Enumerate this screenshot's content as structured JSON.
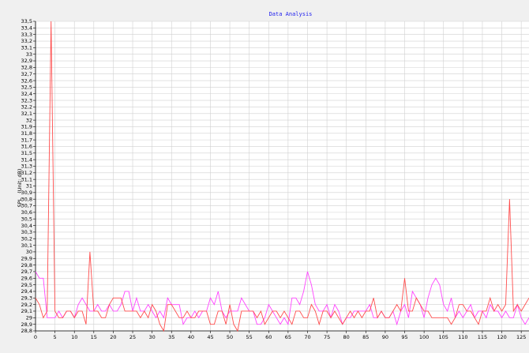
{
  "chart_data": {
    "type": "line",
    "title": "Data Analysis",
    "xlabel": "",
    "ylabel": "SPL",
    "ylabel_unit": "(Unit: dB)",
    "xlim": [
      0,
      127
    ],
    "ylim": [
      28.8,
      33.5
    ],
    "y_step": 0.1,
    "x_ticks": [
      0,
      5,
      10,
      15,
      20,
      25,
      30,
      35,
      40,
      45,
      50,
      55,
      60,
      65,
      70,
      75,
      80,
      85,
      90,
      95,
      100,
      105,
      110,
      115,
      120,
      125
    ],
    "y_tick_labels": [
      "28,8",
      "28,9",
      "29",
      "29,1",
      "29,2",
      "29,3",
      "29,4",
      "29,5",
      "29,6",
      "29,7",
      "29,8",
      "29,9",
      "30",
      "30,1",
      "30,2",
      "30,3",
      "30,4",
      "30,5",
      "30,6",
      "30,7",
      "30,8",
      "30,9",
      "31",
      "31,1",
      "31,2",
      "31,3",
      "31,4",
      "31,5",
      "31,6",
      "31,7",
      "31,8",
      "31,9",
      "32",
      "32,1",
      "32,2",
      "32,3",
      "32,4",
      "32,5",
      "32,6",
      "32,7",
      "32,8",
      "32,9",
      "33",
      "33,1",
      "33,2",
      "33,3",
      "33,4",
      "33,5"
    ],
    "grid": true,
    "background": "#f0f0f0",
    "plot_background": "#ffffff",
    "grid_color": "#d0d0d0",
    "series": [
      {
        "color": "#ff4d4d",
        "x": [
          0,
          1,
          2,
          3,
          4,
          5,
          6,
          7,
          8,
          9,
          10,
          11,
          12,
          13,
          14,
          15,
          16,
          17,
          18,
          19,
          20,
          21,
          22,
          23,
          24,
          25,
          26,
          27,
          28,
          29,
          30,
          31,
          32,
          33,
          34,
          35,
          36,
          37,
          38,
          39,
          40,
          41,
          42,
          43,
          44,
          45,
          46,
          47,
          48,
          49,
          50,
          51,
          52,
          53,
          54,
          55,
          56,
          57,
          58,
          59,
          60,
          61,
          62,
          63,
          64,
          65,
          66,
          67,
          68,
          69,
          70,
          71,
          72,
          73,
          74,
          75,
          76,
          77,
          78,
          79,
          80,
          81,
          82,
          83,
          84,
          85,
          86,
          87,
          88,
          89,
          90,
          91,
          92,
          93,
          94,
          95,
          96,
          97,
          98,
          99,
          100,
          101,
          102,
          103,
          104,
          105,
          106,
          107,
          108,
          109,
          110,
          111,
          112,
          113,
          114,
          115,
          116,
          117,
          118,
          119,
          120,
          121,
          122,
          123,
          124,
          125,
          126,
          127
        ],
        "values": [
          29.3,
          29.2,
          29.0,
          29.1,
          33.5,
          29.1,
          29.0,
          29.0,
          29.1,
          29.1,
          29.0,
          29.1,
          29.1,
          28.9,
          30.0,
          29.1,
          29.1,
          29.0,
          29.0,
          29.2,
          29.3,
          29.3,
          29.3,
          29.1,
          29.1,
          29.1,
          29.1,
          29.0,
          29.1,
          29.0,
          29.2,
          29.1,
          28.9,
          28.8,
          29.2,
          29.2,
          29.1,
          29.0,
          29.0,
          29.1,
          29.0,
          29.0,
          29.1,
          29.1,
          29.1,
          28.9,
          28.9,
          29.1,
          29.1,
          28.9,
          29.2,
          28.9,
          28.8,
          29.1,
          29.1,
          29.1,
          29.1,
          29.0,
          29.1,
          28.9,
          29.0,
          29.1,
          29.1,
          29.0,
          29.1,
          29.0,
          28.9,
          29.1,
          29.1,
          29.0,
          29.0,
          29.2,
          29.1,
          28.9,
          29.1,
          29.1,
          29.0,
          29.1,
          29.0,
          28.9,
          29.0,
          29.1,
          29.0,
          29.1,
          29.0,
          29.1,
          29.1,
          29.3,
          29.0,
          29.1,
          29.0,
          29.0,
          29.1,
          29.2,
          29.1,
          29.6,
          29.1,
          29.1,
          29.3,
          29.2,
          29.1,
          29.1,
          29.0,
          29.0,
          29.0,
          29.0,
          29.0,
          28.9,
          29.0,
          29.2,
          29.2,
          29.1,
          29.1,
          29.0,
          28.9,
          29.1,
          29.1,
          29.3,
          29.1,
          29.2,
          29.1,
          29.2,
          30.8,
          29.1,
          29.2,
          29.1,
          29.2,
          29.3
        ]
      },
      {
        "color": "#ff44ff",
        "x": [
          0,
          1,
          2,
          3,
          4,
          5,
          6,
          7,
          8,
          9,
          10,
          11,
          12,
          13,
          14,
          15,
          16,
          17,
          18,
          19,
          20,
          21,
          22,
          23,
          24,
          25,
          26,
          27,
          28,
          29,
          30,
          31,
          32,
          33,
          34,
          35,
          36,
          37,
          38,
          39,
          40,
          41,
          42,
          43,
          44,
          45,
          46,
          47,
          48,
          49,
          50,
          51,
          52,
          53,
          54,
          55,
          56,
          57,
          58,
          59,
          60,
          61,
          62,
          63,
          64,
          65,
          66,
          67,
          68,
          69,
          70,
          71,
          72,
          73,
          74,
          75,
          76,
          77,
          78,
          79,
          80,
          81,
          82,
          83,
          84,
          85,
          86,
          87,
          88,
          89,
          90,
          91,
          92,
          93,
          94,
          95,
          96,
          97,
          98,
          99,
          100,
          101,
          102,
          103,
          104,
          105,
          106,
          107,
          108,
          109,
          110,
          111,
          112,
          113,
          114,
          115,
          116,
          117,
          118,
          119,
          120,
          121,
          122,
          123,
          124,
          125,
          126,
          127
        ],
        "values": [
          29.7,
          29.6,
          29.6,
          29.0,
          29.0,
          29.0,
          29.1,
          29.0,
          29.1,
          29.1,
          29.0,
          29.2,
          29.3,
          29.2,
          29.1,
          29.1,
          29.2,
          29.1,
          29.1,
          29.2,
          29.1,
          29.1,
          29.2,
          29.4,
          29.4,
          29.1,
          29.3,
          29.1,
          29.1,
          29.2,
          29.1,
          29.0,
          29.1,
          29.0,
          29.3,
          29.2,
          29.2,
          29.2,
          28.9,
          29.0,
          29.0,
          29.1,
          29.0,
          29.1,
          29.1,
          29.3,
          29.2,
          29.4,
          29.1,
          29.0,
          29.1,
          29.1,
          29.1,
          29.3,
          29.2,
          29.1,
          29.1,
          28.9,
          28.9,
          29.0,
          29.2,
          29.1,
          29.0,
          28.9,
          29.0,
          28.9,
          29.3,
          29.3,
          29.2,
          29.4,
          29.7,
          29.5,
          29.2,
          29.1,
          29.1,
          29.2,
          29.0,
          29.2,
          29.1,
          28.9,
          29.0,
          29.0,
          29.1,
          29.1,
          29.1,
          29.1,
          29.2,
          29.0,
          29.0,
          29.1,
          29.0,
          29.0,
          29.1,
          28.9,
          29.1,
          29.2,
          29.0,
          29.4,
          29.3,
          29.2,
          29.0,
          29.3,
          29.5,
          29.6,
          29.5,
          29.2,
          29.1,
          29.3,
          29.0,
          29.1,
          29.0,
          29.1,
          29.2,
          29.0,
          29.1,
          29.1,
          29.0,
          29.2,
          29.1,
          29.1,
          29.0,
          29.1,
          29.0,
          29.0,
          29.2,
          29.0,
          28.9,
          29.0
        ]
      }
    ]
  }
}
